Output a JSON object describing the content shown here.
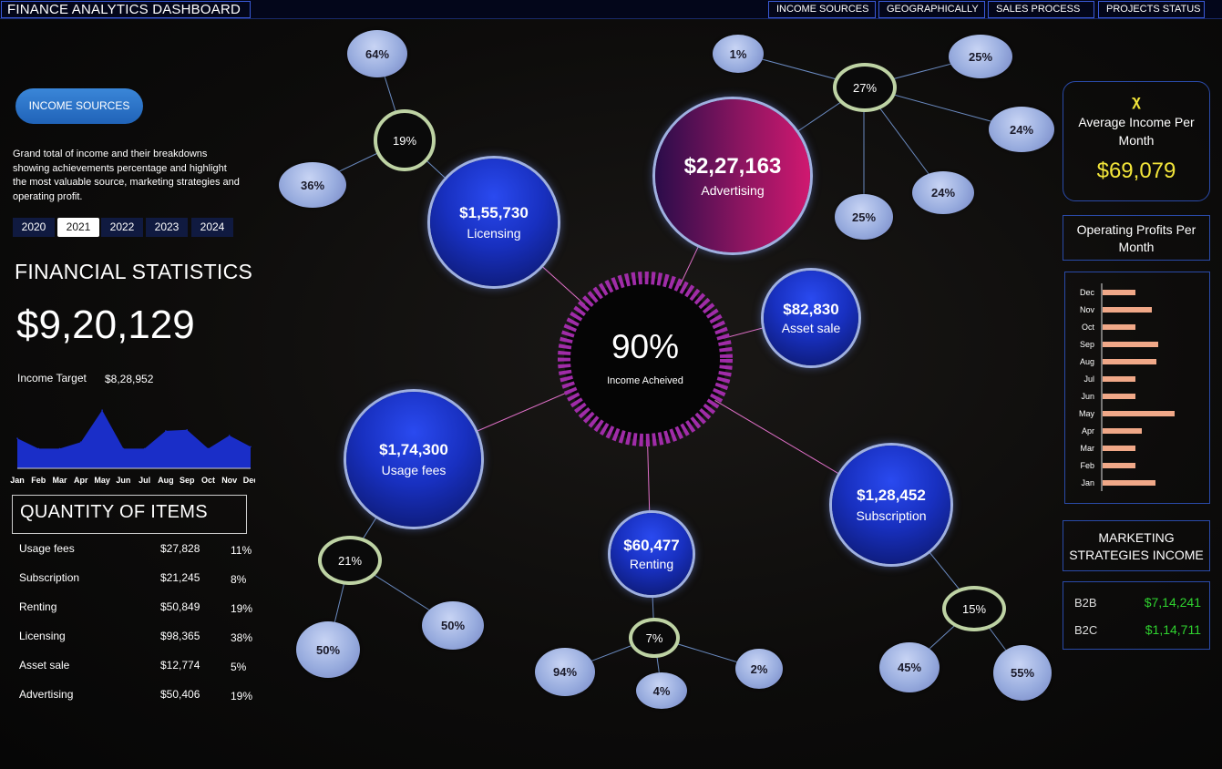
{
  "header": {
    "title": "FINANCE ANALYTICS DASHBOARD",
    "nav": [
      "INCOME SOURCES",
      "GEOGRAPHICALLY",
      "SALES PROCESS",
      "PROJECTS STATUS"
    ]
  },
  "sidebar": {
    "button_label": "INCOME SOURCES",
    "description": "Grand total of income and their breakdowns showing achievements percentage and highlight the most valuable source, marketing strategies and operating profit.",
    "years": [
      "2020",
      "2021",
      "2022",
      "2023",
      "2024"
    ],
    "active_year": "2021"
  },
  "financial": {
    "title": "FINANCIAL STATISTICS",
    "total": "$9,20,129",
    "target_label": "Income Target",
    "target_value": "$8,28,952"
  },
  "chart_data": [
    {
      "type": "area",
      "categories": [
        "Jan",
        "Feb",
        "Mar",
        "Apr",
        "May",
        "Jun",
        "Jul",
        "Aug",
        "Sep",
        "Oct",
        "Nov",
        "Dec"
      ],
      "values": [
        32,
        21,
        21,
        28,
        62,
        21,
        21,
        40,
        41,
        21,
        35,
        23
      ],
      "ylim": [
        0,
        70
      ],
      "color": "#1a2ec8"
    },
    {
      "type": "bar",
      "orientation": "horizontal",
      "categories": [
        "Dec",
        "Nov",
        "Oct",
        "Sep",
        "Aug",
        "Jul",
        "Jun",
        "May",
        "Apr",
        "Mar",
        "Feb",
        "Jan"
      ],
      "values": [
        36,
        54,
        36,
        61,
        59,
        36,
        36,
        79,
        43,
        36,
        36,
        58
      ],
      "ylim": [
        0,
        100
      ],
      "color": "#f0a888"
    }
  ],
  "quantity": {
    "title": "QUANTITY OF ITEMS",
    "rows": [
      {
        "name": "Usage fees",
        "value": "$27,828",
        "pct": "11%"
      },
      {
        "name": "Subscription",
        "value": "$21,245",
        "pct": "8%"
      },
      {
        "name": "Renting",
        "value": "$50,849",
        "pct": "19%"
      },
      {
        "name": "Licensing",
        "value": "$98,365",
        "pct": "38%"
      },
      {
        "name": "Asset sale",
        "value": "$12,774",
        "pct": "5%"
      },
      {
        "name": "Advertising",
        "value": "$50,406",
        "pct": "19%"
      }
    ]
  },
  "center": {
    "pct": "90%",
    "label": "Income Acheived"
  },
  "sources": {
    "licensing": {
      "value": "$1,55,730",
      "label": "Licensing",
      "ring": "19%",
      "subs": [
        "64%",
        "36%"
      ]
    },
    "advertising": {
      "value": "$2,27,163",
      "label": "Advertising",
      "ring": "27%",
      "subs": [
        "1%",
        "25%",
        "24%",
        "24%",
        "25%"
      ]
    },
    "asset_sale": {
      "value": "$82,830",
      "label": "Asset sale"
    },
    "usage_fees": {
      "value": "$1,74,300",
      "label": "Usage fees",
      "ring": "21%",
      "subs": [
        "50%",
        "50%"
      ]
    },
    "renting": {
      "value": "$60,477",
      "label": "Renting",
      "ring": "7%",
      "subs": [
        "94%",
        "4%",
        "2%"
      ]
    },
    "subscription": {
      "value": "$1,28,452",
      "label": "Subscription",
      "ring": "15%",
      "subs": [
        "45%",
        "55%"
      ]
    }
  },
  "right": {
    "avg_icon": "χ",
    "avg_title": "Average Income Per Month",
    "avg_value": "$69,079",
    "op_title": "Operating Profits Per Month",
    "marketing_title": "MARKETING STRATEGIES INCOME",
    "b2b_label": "B2B",
    "b2b_value": "$7,14,241",
    "b2c_label": "B2C",
    "b2c_value": "$1,14,711"
  }
}
